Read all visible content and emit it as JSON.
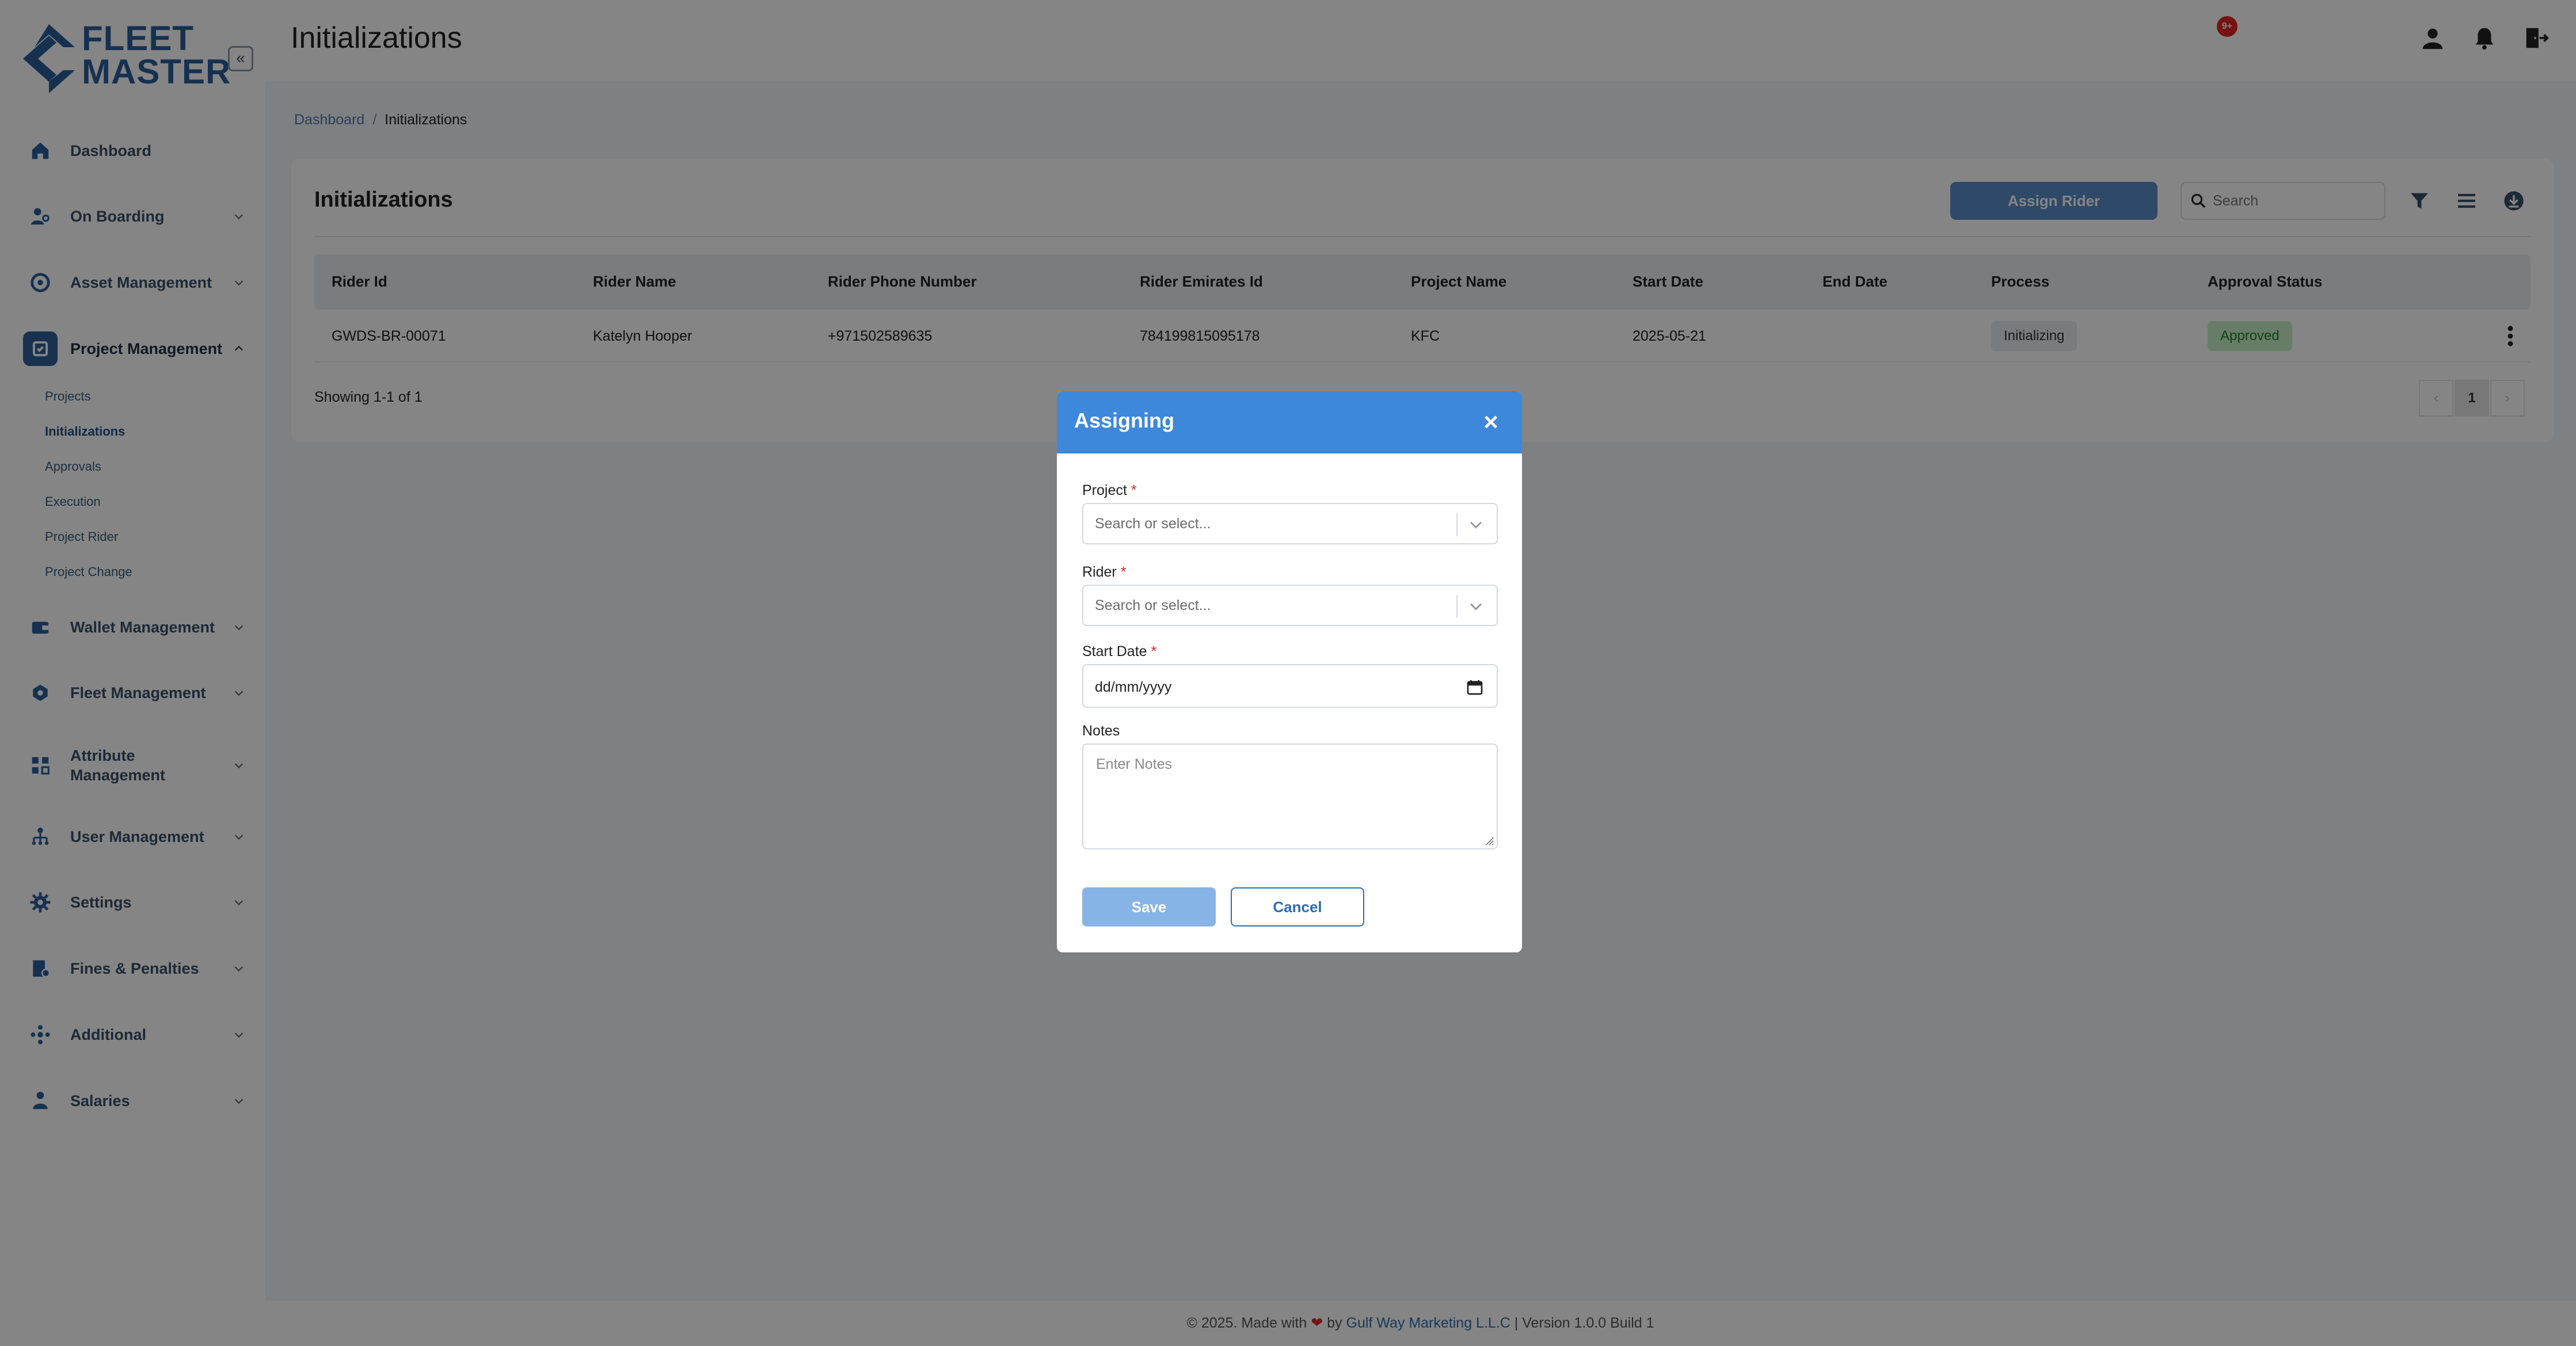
{
  "app": {
    "brand_line1": "FLEET",
    "brand_line2": "MASTER",
    "collapse_glyph": "«"
  },
  "sidebar": {
    "items": [
      {
        "label": "Dashboard",
        "icon": "home-icon"
      },
      {
        "label": "On Boarding",
        "icon": "onboarding-icon"
      },
      {
        "label": "Asset Management",
        "icon": "asset-icon"
      },
      {
        "label": "Project Management",
        "icon": "project-icon",
        "active": true
      },
      {
        "label": "Wallet Management",
        "icon": "wallet-icon"
      },
      {
        "label": "Fleet Management",
        "icon": "fleet-icon"
      },
      {
        "label": "Attribute Management",
        "icon": "attribute-icon"
      },
      {
        "label": "User Management",
        "icon": "user-mgmt-icon"
      },
      {
        "label": "Settings",
        "icon": "gear-icon"
      },
      {
        "label": "Fines & Penalties",
        "icon": "fines-icon"
      },
      {
        "label": "Additional",
        "icon": "additional-icon"
      },
      {
        "label": "Salaries",
        "icon": "salaries-icon"
      }
    ],
    "sub_items": [
      {
        "label": "Projects"
      },
      {
        "label": "Initializations",
        "active": true
      },
      {
        "label": "Approvals"
      },
      {
        "label": "Execution"
      },
      {
        "label": "Project Rider"
      },
      {
        "label": "Project Change"
      }
    ]
  },
  "header": {
    "title": "Initializations",
    "notification_count": "9+"
  },
  "breadcrumb": {
    "home": "Dashboard",
    "separator": "/",
    "current": "Initializations"
  },
  "card": {
    "title": "Initializations",
    "assign_button": "Assign Rider",
    "search_placeholder": "Search"
  },
  "table": {
    "columns": [
      "Rider Id",
      "Rider Name",
      "Rider Phone Number",
      "Rider Emirates Id",
      "Project Name",
      "Start Date",
      "End Date",
      "Process",
      "Approval Status"
    ],
    "rows": [
      {
        "rider_id": "GWDS-BR-00071",
        "rider_name": "Katelyn Hooper",
        "phone": "+971502589635",
        "emirates_id": "784199815095178",
        "project": "KFC",
        "start_date": "2025-05-21",
        "end_date": "",
        "process": "Initializing",
        "approval": "Approved"
      }
    ],
    "showing": "Showing 1-1 of 1",
    "page": "1",
    "prev_glyph": "‹",
    "next_glyph": "›"
  },
  "footer": {
    "prefix": "© 2025. Made with",
    "heart": "❤",
    "by": "by",
    "company": "Gulf Way Marketing L.L.C",
    "version": "| Version 1.0.0 Build 1"
  },
  "modal": {
    "title": "Assigning",
    "close_glyph": "×",
    "project_label": "Project",
    "rider_label": "Rider",
    "start_date_label": "Start Date",
    "notes_label": "Notes",
    "required_mark": "*",
    "select_placeholder": "Search or select...",
    "date_placeholder": "dd/mm/yyyy",
    "notes_placeholder": "Enter Notes",
    "save": "Save",
    "cancel": "Cancel"
  },
  "colors": {
    "brand": "#2b5f99",
    "modal_header": "#3d88da",
    "approved_bg": "#c8efc8",
    "badge_red": "#e02424"
  }
}
